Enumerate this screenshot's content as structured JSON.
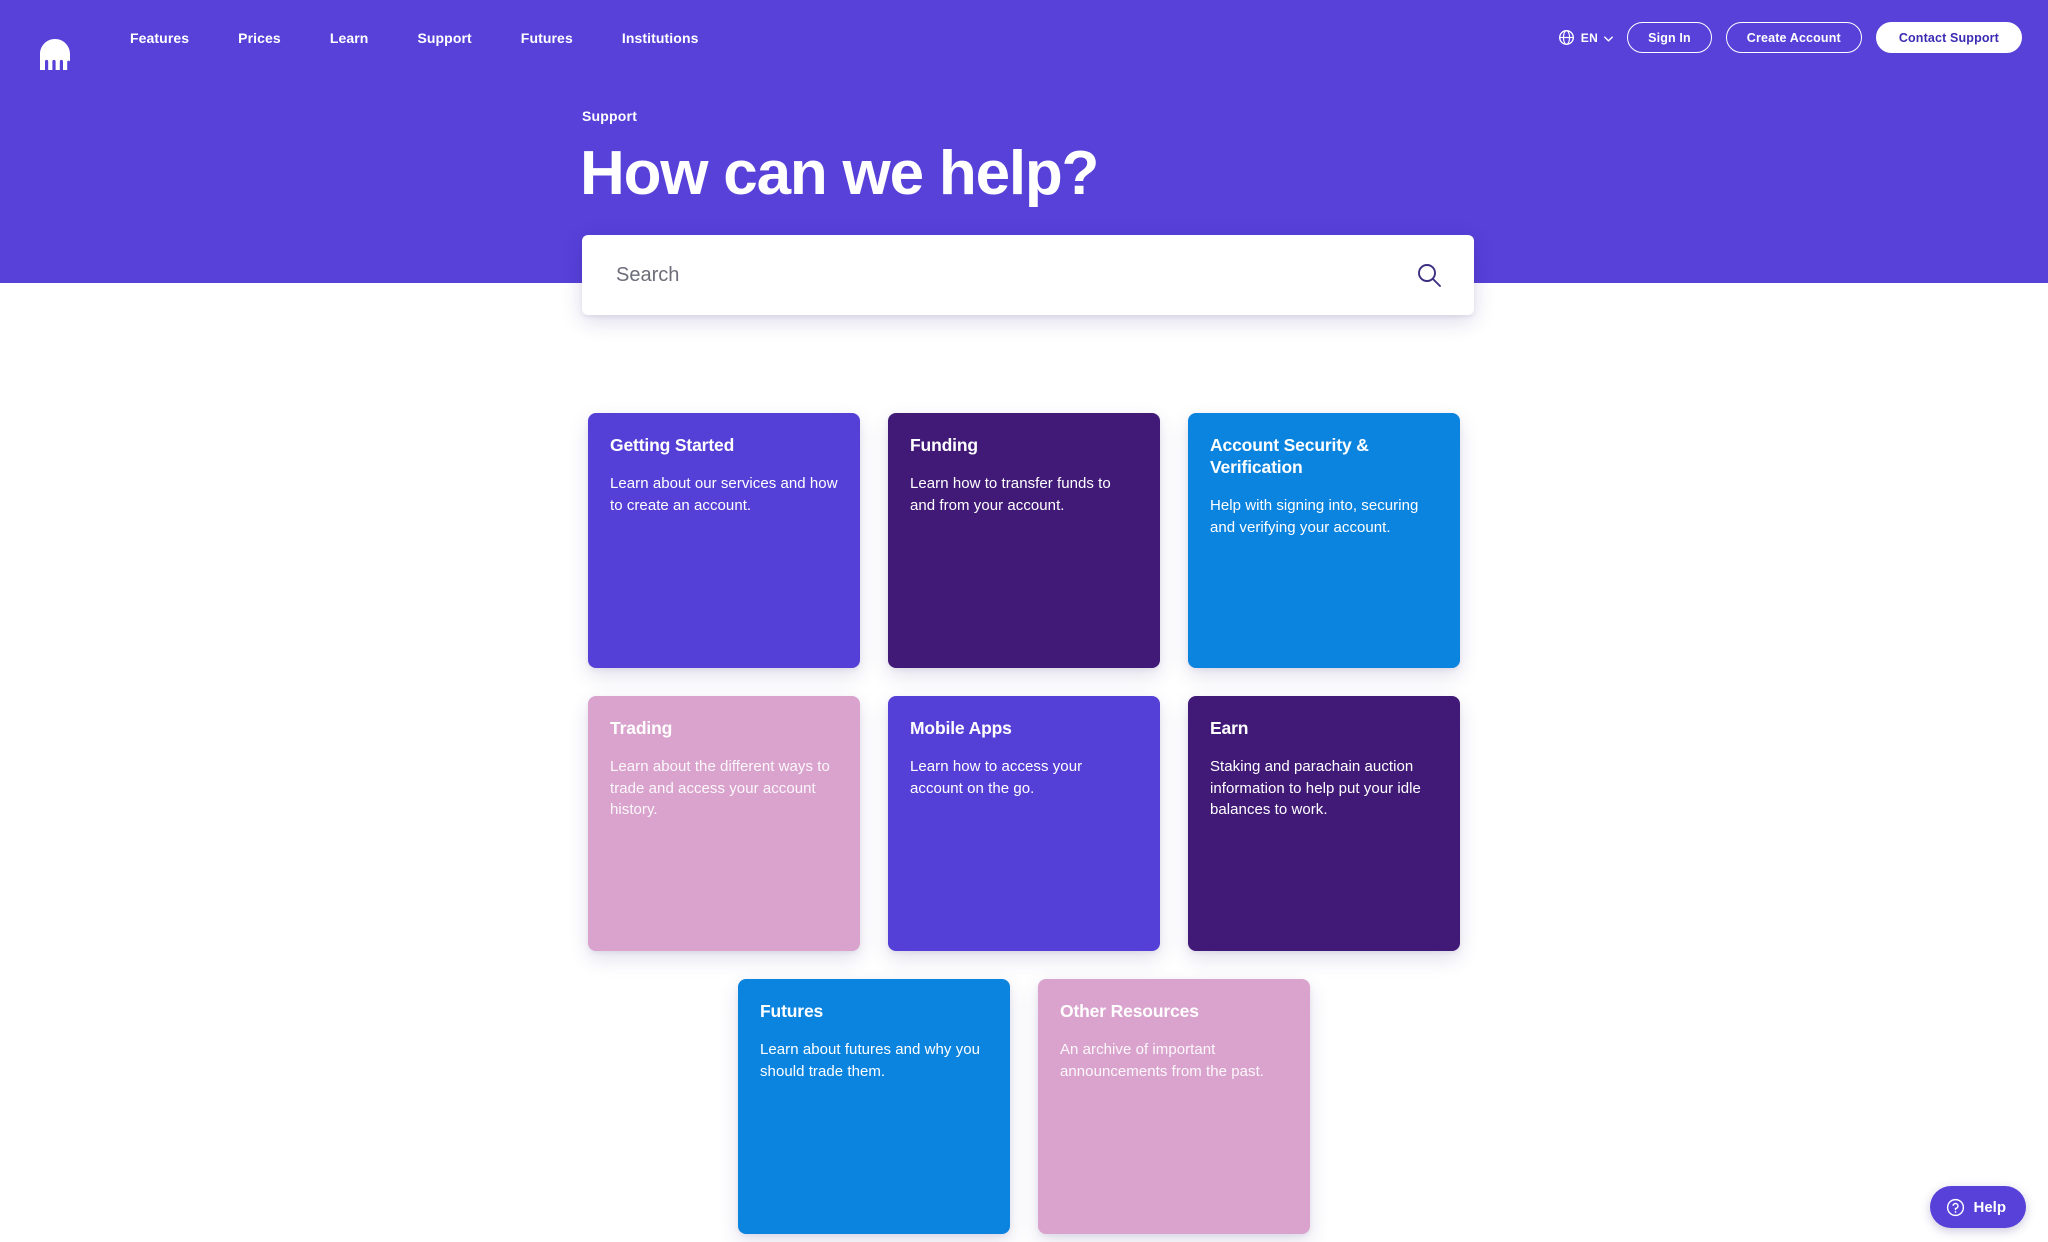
{
  "theme": {
    "brand_purple": "#5741d9",
    "dark_purple": "#411a78",
    "blue": "#0b84e0",
    "pink": "#d9a3cd",
    "card_purple": "#5440d6",
    "white": "#ffffff"
  },
  "nav": {
    "logo_name": "kraken-octopus-logo",
    "links": [
      {
        "label": "Features"
      },
      {
        "label": "Prices"
      },
      {
        "label": "Learn"
      },
      {
        "label": "Support"
      },
      {
        "label": "Futures"
      },
      {
        "label": "Institutions"
      }
    ],
    "language": {
      "icon": "globe-icon",
      "label": "EN",
      "chevron": "chevron-down-icon"
    },
    "sign_in_label": "Sign In",
    "create_account_label": "Create Account",
    "contact_support_label": "Contact Support"
  },
  "hero": {
    "eyebrow": "Support",
    "title": "How can we help?"
  },
  "search": {
    "placeholder": "Search",
    "value": "",
    "icon": "search-icon"
  },
  "cards": {
    "rows": [
      [
        {
          "title": "Getting Started",
          "desc": "Learn about our services and how to create an account.",
          "color": "#5440d6",
          "style": "purple"
        },
        {
          "title": "Funding",
          "desc": "Learn how to transfer funds to and from your account.",
          "color": "#411a78",
          "style": "darkpurple"
        },
        {
          "title": "Account Security & Verification",
          "desc": "Help with signing into, securing and verifying your account.",
          "color": "#0b84e0",
          "style": "blue"
        }
      ],
      [
        {
          "title": "Trading",
          "desc": "Learn about the different ways to trade and access your account history.",
          "color": "#d9a3cd",
          "style": "pink"
        },
        {
          "title": "Mobile Apps",
          "desc": "Learn how to access your account on the go.",
          "color": "#5440d6",
          "style": "purple"
        },
        {
          "title": "Earn",
          "desc": "Staking and parachain auction information to help put your idle balances to work.",
          "color": "#411a78",
          "style": "darkpurple"
        }
      ],
      [
        {
          "title": "Futures",
          "desc": "Learn about futures and why you should trade them.",
          "color": "#0b84e0",
          "style": "blue"
        },
        {
          "title": "Other Resources",
          "desc": "An archive of important announcements from the past.",
          "color": "#d9a3cd",
          "style": "pink"
        }
      ]
    ]
  },
  "help_widget": {
    "label": "Help",
    "icon": "question-circle-icon"
  }
}
